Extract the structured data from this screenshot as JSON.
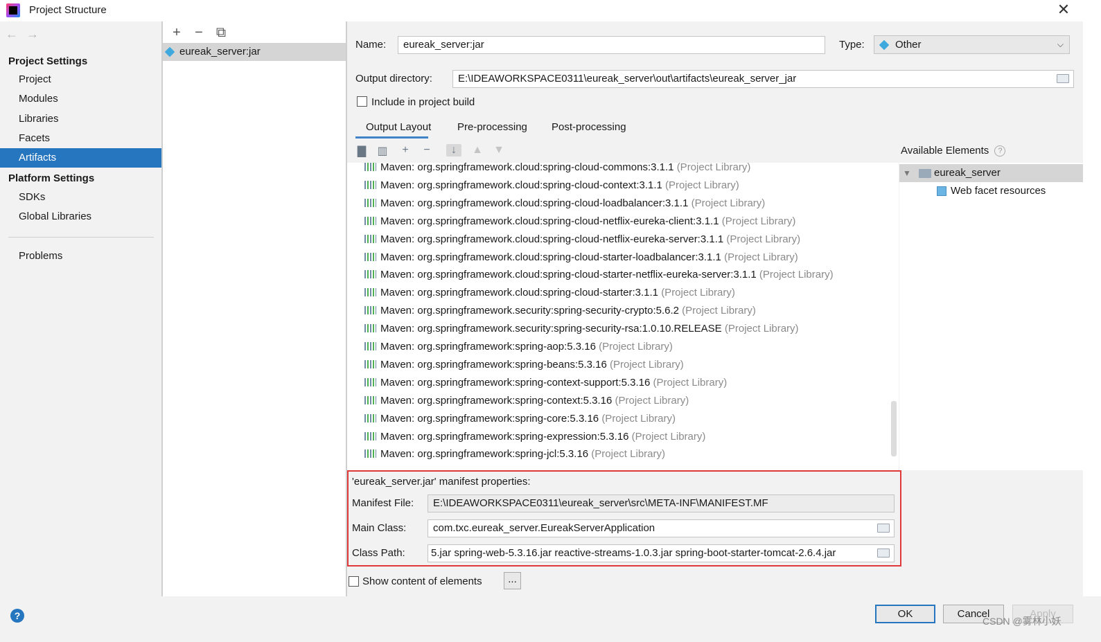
{
  "window": {
    "title": "Project Structure"
  },
  "sidebar": {
    "project_settings_header": "Project Settings",
    "project_items": [
      "Project",
      "Modules",
      "Libraries",
      "Facets",
      "Artifacts"
    ],
    "platform_settings_header": "Platform Settings",
    "platform_items": [
      "SDKs",
      "Global Libraries"
    ],
    "problems": "Problems",
    "selected": "Artifacts"
  },
  "artifacts": {
    "items": [
      "eureak_server:jar"
    ]
  },
  "form": {
    "name_label": "Name:",
    "name_value": "eureak_server:jar",
    "type_label": "Type:",
    "type_value": "Other",
    "output_dir_label": "Output directory:",
    "output_dir_value": "E:\\IDEAWORKSPACE0311\\eureak_server\\out\\artifacts\\eureak_server_jar",
    "include_build_label": "Include in project build"
  },
  "tabs": [
    "Output Layout",
    "Pre-processing",
    "Post-processing"
  ],
  "layout_tree": {
    "suffix": "(Project Library)",
    "rows": [
      "Maven: org.springframework.cloud:spring-cloud-commons:3.1.1",
      "Maven: org.springframework.cloud:spring-cloud-context:3.1.1",
      "Maven: org.springframework.cloud:spring-cloud-loadbalancer:3.1.1",
      "Maven: org.springframework.cloud:spring-cloud-netflix-eureka-client:3.1.1",
      "Maven: org.springframework.cloud:spring-cloud-netflix-eureka-server:3.1.1",
      "Maven: org.springframework.cloud:spring-cloud-starter-loadbalancer:3.1.1",
      "Maven: org.springframework.cloud:spring-cloud-starter-netflix-eureka-server:3.1.1",
      "Maven: org.springframework.cloud:spring-cloud-starter:3.1.1",
      "Maven: org.springframework.security:spring-security-crypto:5.6.2",
      "Maven: org.springframework.security:spring-security-rsa:1.0.10.RELEASE",
      "Maven: org.springframework:spring-aop:5.3.16",
      "Maven: org.springframework:spring-beans:5.3.16",
      "Maven: org.springframework:spring-context-support:5.3.16",
      "Maven: org.springframework:spring-context:5.3.16",
      "Maven: org.springframework:spring-core:5.3.16",
      "Maven: org.springframework:spring-expression:5.3.16",
      "Maven: org.springframework:spring-jcl:5.3.16"
    ]
  },
  "available": {
    "title": "Available Elements",
    "help": "?",
    "root": "eureak_server",
    "child": "Web facet resources"
  },
  "manifest": {
    "title": "'eureak_server.jar' manifest properties:",
    "file_label": "Manifest File:",
    "file_value": "E:\\IDEAWORKSPACE0311\\eureak_server\\src\\META-INF\\MANIFEST.MF",
    "main_class_label": "Main Class:",
    "main_class_value": "com.txc.eureak_server.EureakServerApplication",
    "class_path_label": "Class Path:",
    "class_path_value": "5.jar spring-web-5.3.16.jar reactive-streams-1.0.3.jar spring-boot-starter-tomcat-2.6.4.jar"
  },
  "show_content_label": "Show content of elements",
  "ellipsis": "...",
  "footer": {
    "ok": "OK",
    "cancel": "Cancel",
    "apply": "Apply",
    "help": "?",
    "watermark": "CSDN @雾林小妖"
  },
  "colors": {
    "selection": "#2675bf",
    "highlight_box": "#e03838",
    "tab_underline": "#4083c9"
  }
}
